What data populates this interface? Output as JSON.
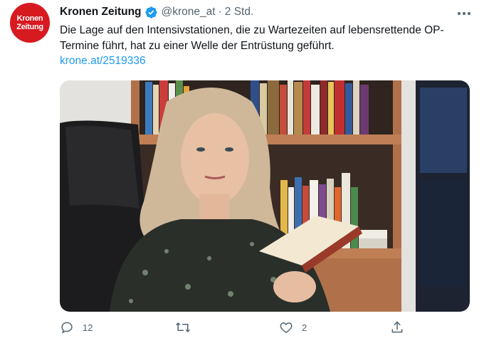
{
  "account": {
    "avatar_text_line1": "Kronen",
    "avatar_text_line2": "Zeitung",
    "name": "Kronen Zeitung",
    "handle": "@krone_at",
    "separator": "·",
    "time": "2 Std."
  },
  "tweet": {
    "text": "Die Lage auf den Intensivstationen, die zu Wartezeiten auf lebensrettende OP-Termine führt, hat zu einer Welle der Entrüstung geführt.",
    "link": "krone.at/2519336"
  },
  "actions": {
    "reply_count": "12",
    "like_count": "2"
  },
  "colors": {
    "brand": "#d71920",
    "link": "#1d9bf0",
    "verified": "#1d9bf0",
    "icon": "#536471"
  }
}
